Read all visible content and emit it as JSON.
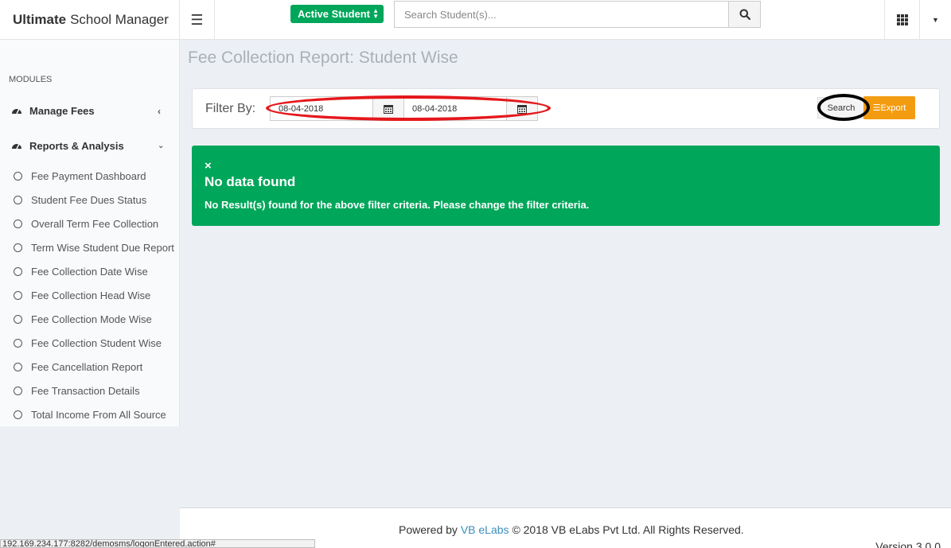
{
  "brand": {
    "bold": "Ultimate",
    "rest": "School Manager"
  },
  "header": {
    "status_select": "Active Student",
    "search_placeholder": "Search Student(s)..."
  },
  "sidebar": {
    "section_label": "MODULES",
    "manage_fees": "Manage Fees",
    "reports": "Reports & Analysis",
    "items": [
      "Fee Payment Dashboard",
      "Student Fee Dues Status",
      "Overall Term Fee Collection",
      "Term Wise Student Due Report",
      "Fee Collection Date Wise",
      "Fee Collection Head Wise",
      "Fee Collection Mode Wise",
      "Fee Collection Student Wise",
      "Fee Cancellation Report",
      "Fee Transaction Details",
      "Total Income From All Source"
    ]
  },
  "main": {
    "title": "Fee Collection Report: Student Wise",
    "filter_label": "Filter By:",
    "date_from": "08-04-2018",
    "date_to": "08-04-2018",
    "search_label": "Search",
    "export_label": "Export"
  },
  "alert": {
    "close": "×",
    "heading": "No data found",
    "message": "No Result(s) found for the above filter criteria. Please change the filter criteria."
  },
  "footer": {
    "powered_by": "Powered by",
    "company_link": "VB eLabs",
    "copyright": "© 2018 VB eLabs Pvt Ltd. All Rights Reserved.",
    "version": "Version 3.0.0"
  },
  "status_url": "192.169.234.177:8282/demosms/logonEntered.action#",
  "colors": {
    "green": "#00a65a",
    "orange": "#f39c12",
    "annotation_red": "#e5171b",
    "link_blue": "#3c8dbc"
  }
}
